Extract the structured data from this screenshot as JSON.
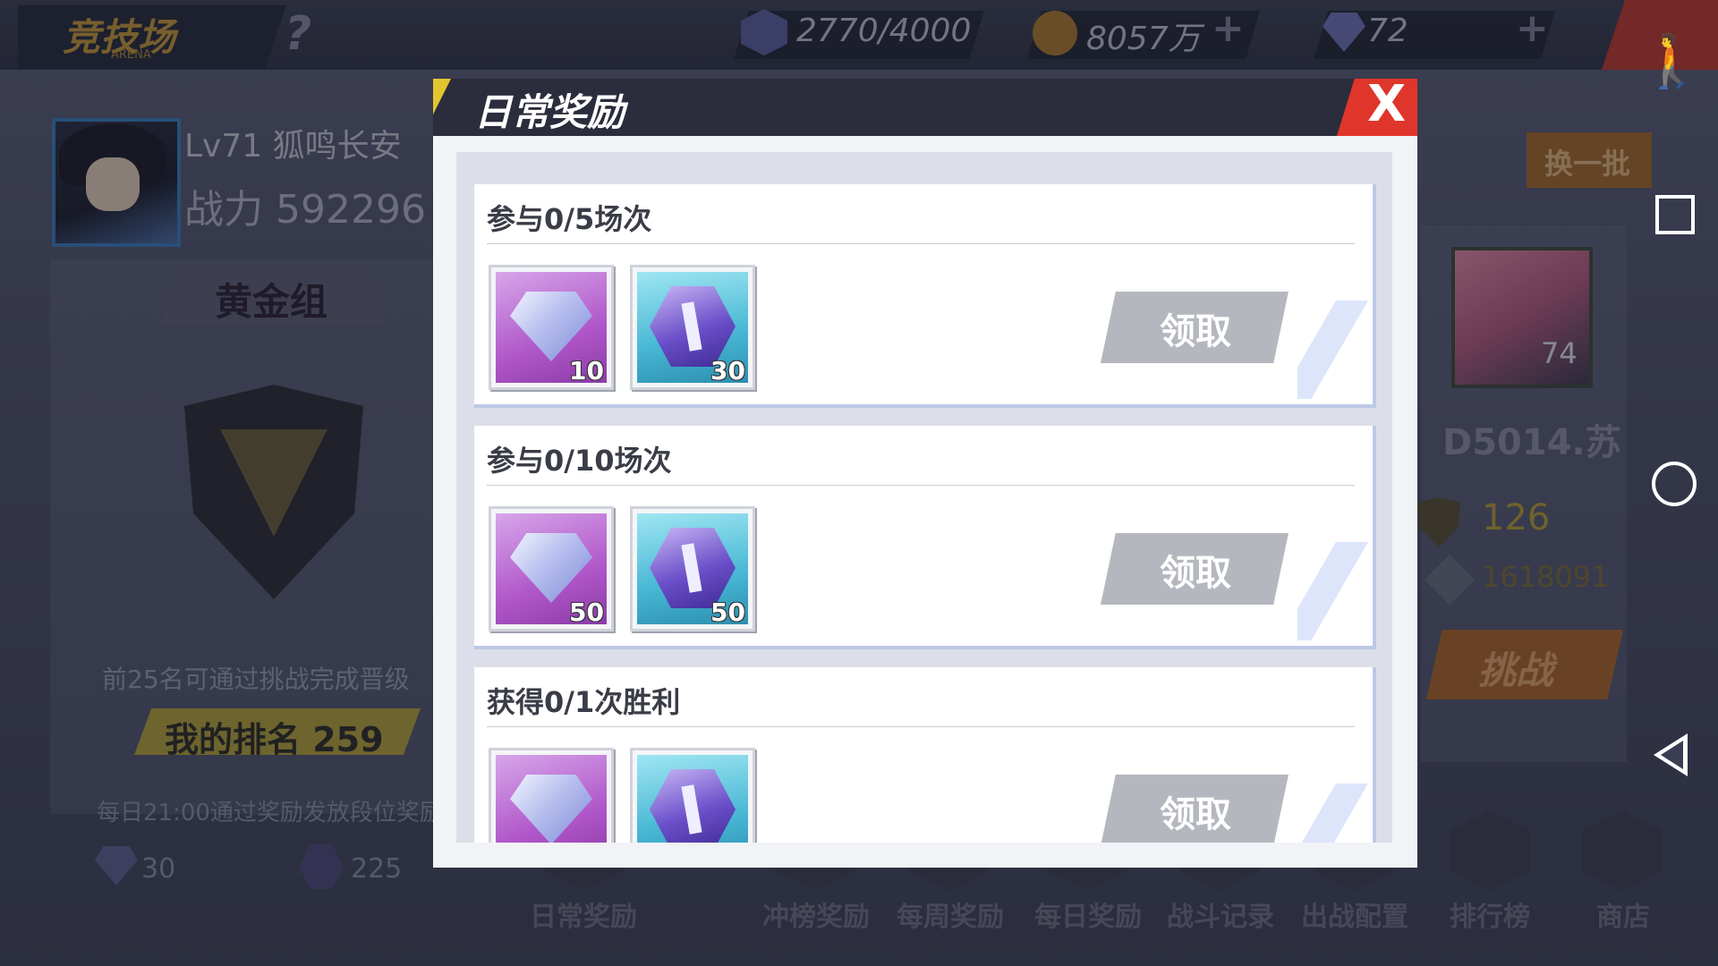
{
  "header": {
    "arena_title": "竞技场",
    "arena_subtitle": "ARENA",
    "help": "?",
    "stamina": "2770/4000",
    "gold": "8057万",
    "gems": "72",
    "plus": "+"
  },
  "player": {
    "level_name": "Lv71  狐鸣长安",
    "power": "战力 592296",
    "group": "黄金组",
    "rule": "前25名可通过挑战完成晋级",
    "rank": "我的排名 259",
    "reward_note": "每日21:00通过奖励发放段位奖励",
    "gem_reward": "30",
    "coin_reward": "225"
  },
  "opponent": {
    "swap": "换一批",
    "level": "74",
    "name": "D5014.苏",
    "rank": "126",
    "power": "1618091",
    "challenge": "挑战"
  },
  "nav": [
    {
      "label": "日常奖励"
    },
    {
      "label": "冲榜奖励"
    },
    {
      "label": "每周奖励"
    },
    {
      "label": "每日奖励"
    },
    {
      "label": "战斗记录"
    },
    {
      "label": "出战配置"
    },
    {
      "label": "排行榜"
    },
    {
      "label": "商店"
    }
  ],
  "modal": {
    "title": "日常奖励",
    "close": "X",
    "tasks": [
      {
        "title": "参与0/5场次",
        "gem_qty": "10",
        "coin_qty": "30",
        "claim": "领取"
      },
      {
        "title": "参与0/10场次",
        "gem_qty": "50",
        "coin_qty": "50",
        "claim": "领取"
      },
      {
        "title": "获得0/1次胜利",
        "gem_qty": "",
        "coin_qty": "",
        "claim": "领取"
      }
    ]
  },
  "colors": {
    "accent_red": "#e0352a",
    "accent_yellow": "#e3c530",
    "modal_header": "#2b2d3c"
  }
}
